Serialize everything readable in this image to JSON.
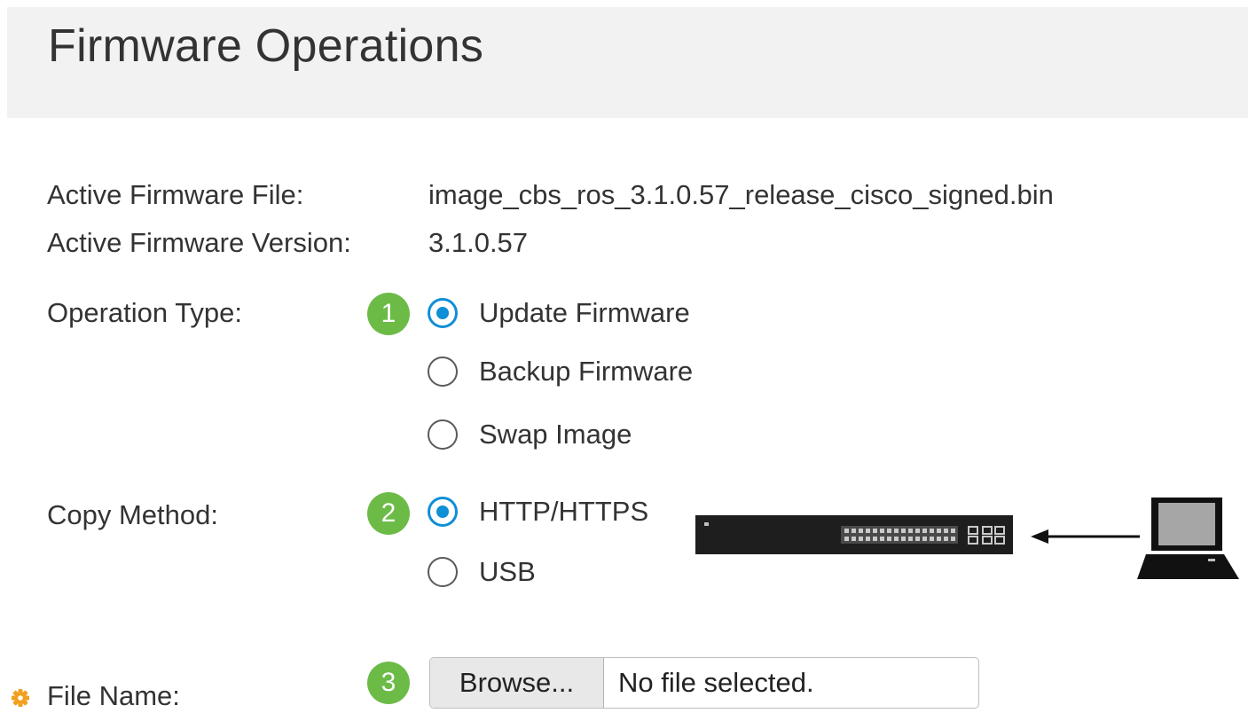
{
  "page": {
    "title": "Firmware Operations"
  },
  "firmware": {
    "active_file_label": "Active Firmware File:",
    "active_file_value": "image_cbs_ros_3.1.0.57_release_cisco_signed.bin",
    "active_version_label": "Active Firmware Version:",
    "active_version_value": "3.1.0.57"
  },
  "operation_type": {
    "label": "Operation Type:",
    "step": "1",
    "options": [
      {
        "label": "Update Firmware",
        "checked": true
      },
      {
        "label": "Backup Firmware",
        "checked": false
      },
      {
        "label": "Swap Image",
        "checked": false
      }
    ]
  },
  "copy_method": {
    "label": "Copy Method:",
    "step": "2",
    "options": [
      {
        "label": "HTTP/HTTPS",
        "checked": true
      },
      {
        "label": "USB",
        "checked": false
      }
    ],
    "diagram_icons": [
      "network-switch-icon",
      "arrow-left-icon",
      "laptop-icon"
    ]
  },
  "file_name": {
    "label": "File Name:",
    "step": "3",
    "browse_label": "Browse...",
    "status": "No file selected.",
    "required_icon": "required-gear-icon"
  },
  "colors": {
    "header_bg": "#f2f2f2",
    "step_badge": "#6cbb47",
    "radio_checked": "#0f8fd6",
    "required_icon": "#f0a020"
  }
}
